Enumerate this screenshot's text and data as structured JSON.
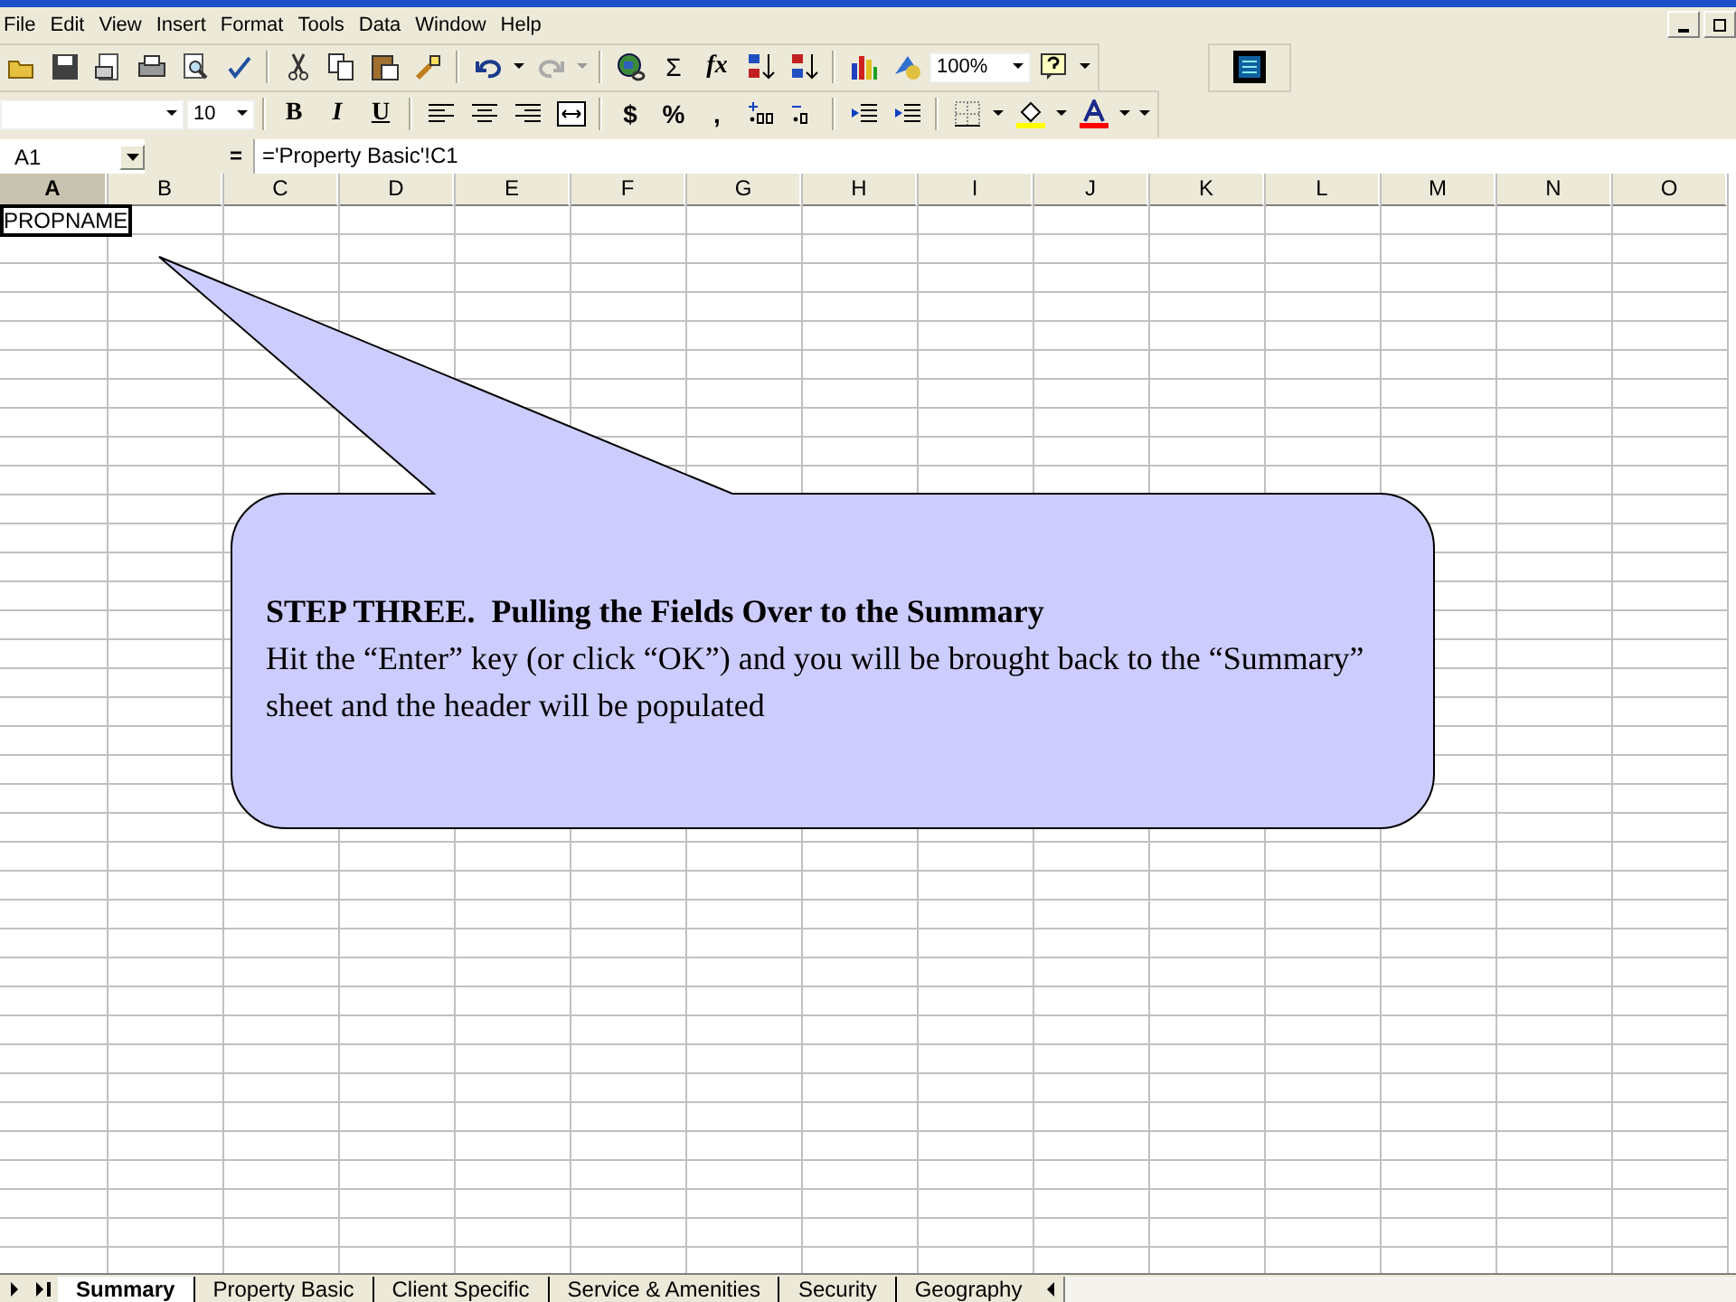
{
  "menu": [
    "File",
    "Edit",
    "View",
    "Insert",
    "Format",
    "Tools",
    "Data",
    "Window",
    "Help"
  ],
  "toolbar_standard": {
    "sum": "Σ",
    "function": "fx",
    "zoom": "100%"
  },
  "toolbar_formatting": {
    "font_size": "10",
    "bold": "B",
    "italic": "I",
    "underline": "U",
    "currency": "$",
    "percent": "%",
    "comma": ","
  },
  "formula_bar": {
    "name_box": "A1",
    "equals": "=",
    "formula": "='Property Basic'!C1"
  },
  "columns": [
    {
      "label": "A",
      "selected": true
    },
    {
      "label": "B",
      "selected": false
    },
    {
      "label": "C",
      "selected": false
    },
    {
      "label": "D",
      "selected": false
    },
    {
      "label": "E",
      "selected": false
    },
    {
      "label": "F",
      "selected": false
    },
    {
      "label": "G",
      "selected": false
    },
    {
      "label": "H",
      "selected": false
    },
    {
      "label": "I",
      "selected": false
    },
    {
      "label": "J",
      "selected": false
    },
    {
      "label": "K",
      "selected": false
    },
    {
      "label": "L",
      "selected": false
    },
    {
      "label": "M",
      "selected": false
    },
    {
      "label": "N",
      "selected": false
    },
    {
      "label": "O",
      "selected": false
    }
  ],
  "cells": {
    "A1": "PROPNAME"
  },
  "callout": {
    "heading": "STEP THREE.  Pulling the Fields Over to the Summary",
    "body": "Hit the “Enter” key (or click “OK”) and you will be brought back to the “Summary” sheet and the header will be populated"
  },
  "sheet_tabs": [
    {
      "label": "Summary",
      "selected": true
    },
    {
      "label": "Property Basic",
      "selected": false
    },
    {
      "label": "Client Specific",
      "selected": false
    },
    {
      "label": "Service & Amenities",
      "selected": false
    },
    {
      "label": "Security",
      "selected": false
    },
    {
      "label": "Geography",
      "selected": false
    }
  ]
}
